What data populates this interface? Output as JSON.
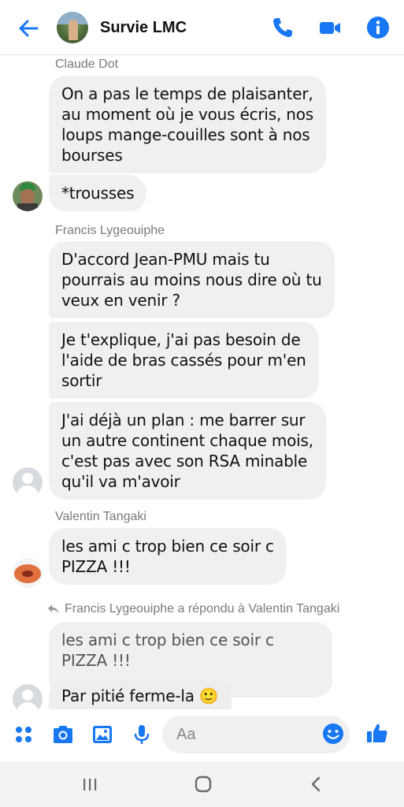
{
  "header": {
    "title": "Survie LMC",
    "icons": {
      "back": "back-arrow-icon",
      "call": "phone-icon",
      "video": "video-camera-icon",
      "info": "info-icon"
    },
    "accent": "#1877f2"
  },
  "messages": [
    {
      "sender": "Claude Dot",
      "lines": [
        "On a pas le temps de plaisanter,",
        "au moment où je vous écris, nos",
        "loups mange-couilles sont à nos",
        "bourses"
      ]
    },
    {
      "lines": [
        "*trousses"
      ]
    },
    {
      "sender": "Francis Lygeouiphe",
      "lines": [
        "D'accord Jean-PMU mais tu",
        "pourrais au moins nous dire où tu",
        "veux en venir ?"
      ]
    },
    {
      "lines": [
        "Je t'explique, j'ai pas besoin de",
        "l'aide de bras cassés pour m'en",
        "sortir"
      ]
    },
    {
      "lines": [
        "J'ai déjà un plan : me barrer sur",
        "un autre continent chaque mois,",
        "c'est pas avec son RSA minable",
        "qu'il va m'avoir"
      ]
    },
    {
      "sender": "Valentin Tangaki",
      "lines": [
        "les ami c trop bien ce soir c",
        "PIZZA !!!"
      ]
    },
    {
      "quoted_lines": [
        "les ami c trop bien ce soir c",
        "PIZZA !!!"
      ]
    },
    {
      "lines": [
        "Par pitié ferme-la"
      ],
      "emoji": "🙂"
    }
  ],
  "reply_note": "Francis Lygeouiphe a répondu à Valentin Tangaki",
  "composer": {
    "placeholder": "Aa",
    "icons": [
      "apps-icon",
      "camera-icon",
      "gallery-icon",
      "microphone-icon",
      "emoji-icon",
      "thumbs-up-icon"
    ]
  },
  "navbar": {
    "icons": [
      "recent-apps-icon",
      "home-icon",
      "back-icon"
    ]
  },
  "colors": {
    "bubble": "#f0f0f0",
    "sender": "#7a7a7a",
    "accent": "#1877f2"
  }
}
